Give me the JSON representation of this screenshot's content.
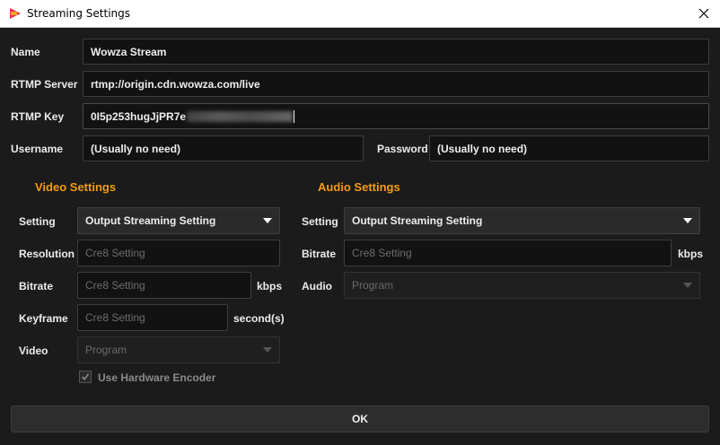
{
  "window": {
    "title": "Streaming Settings"
  },
  "form": {
    "name_label": "Name",
    "name_value": "Wowza Stream",
    "rtmp_server_label": "RTMP Server",
    "rtmp_server_value": "rtmp://origin.cdn.wowza.com/live",
    "rtmp_key_label": "RTMP Key",
    "rtmp_key_value": "0I5p253hugJjPR7e",
    "username_label": "Username",
    "username_value": "(Usually no need)",
    "password_label": "Password",
    "password_value": "(Usually no need)"
  },
  "video": {
    "section_title": "Video Settings",
    "setting_label": "Setting",
    "setting_value": "Output Streaming Setting",
    "resolution_label": "Resolution",
    "resolution_placeholder": "Cre8 Setting",
    "bitrate_label": "Bitrate",
    "bitrate_placeholder": "Cre8 Setting",
    "bitrate_unit": "kbps",
    "keyframe_label": "Keyframe",
    "keyframe_placeholder": "Cre8 Setting",
    "keyframe_unit": "second(s)",
    "video_label": "Video",
    "video_value": "Program",
    "hw_encoder_label": "Use Hardware Encoder",
    "hw_encoder_checked": true
  },
  "audio": {
    "section_title": "Audio Settings",
    "setting_label": "Setting",
    "setting_value": "Output Streaming Setting",
    "bitrate_label": "Bitrate",
    "bitrate_placeholder": "Cre8 Setting",
    "bitrate_unit": "kbps",
    "audio_label": "Audio",
    "audio_value": "Program"
  },
  "footer": {
    "ok_label": "OK"
  },
  "colors": {
    "accent": "#f39c12",
    "background": "#1b1b1b"
  }
}
